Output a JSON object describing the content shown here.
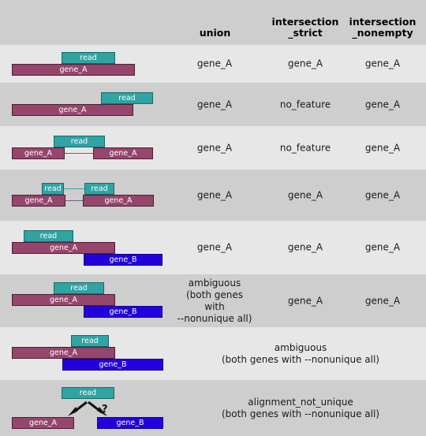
{
  "header": {
    "col_union": "union",
    "col_intersection_strict": "intersection\n_strict",
    "col_intersection_nonempty": "intersection\n_nonempty"
  },
  "labels": {
    "read": "read",
    "gene_a": "gene_A",
    "gene_b": "gene_B",
    "question_mark": "?"
  },
  "colors": {
    "read": "#30a3a3",
    "gene_a": "#96456d",
    "gene_b": "#2200dd",
    "row_light": "#e7e7e7",
    "row_dark": "#cecece",
    "text": "#1a1a1a"
  },
  "rows": [
    {
      "id": "row-1",
      "union": "gene_A",
      "intersection_strict": "gene_A",
      "intersection_nonempty": "gene_A"
    },
    {
      "id": "row-2",
      "union": "gene_A",
      "intersection_strict": "no_feature",
      "intersection_nonempty": "gene_A"
    },
    {
      "id": "row-3",
      "union": "gene_A",
      "intersection_strict": "no_feature",
      "intersection_nonempty": "gene_A"
    },
    {
      "id": "row-4",
      "union": "gene_A",
      "intersection_strict": "gene_A",
      "intersection_nonempty": "gene_A"
    },
    {
      "id": "row-5",
      "union": "gene_A",
      "intersection_strict": "gene_A",
      "intersection_nonempty": "gene_A"
    },
    {
      "id": "row-6",
      "union": "ambiguous\n(both genes with\n--nonunique all)",
      "intersection_strict": "gene_A",
      "intersection_nonempty": "gene_A"
    },
    {
      "id": "row-7",
      "merged": "ambiguous\n(both genes with --nonunique all)"
    },
    {
      "id": "row-8",
      "merged": "alignment_not_unique\n(both genes with --nonunique all)"
    }
  ]
}
